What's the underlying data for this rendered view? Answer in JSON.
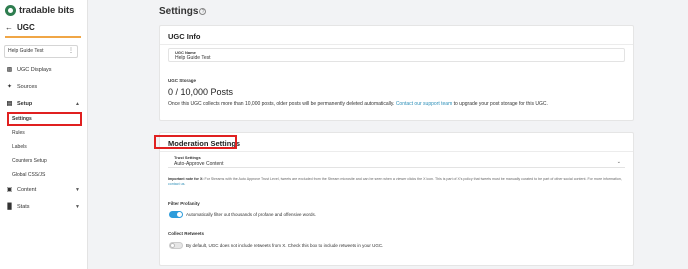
{
  "sidebar": {
    "brand": "tradable bits",
    "back_label": "UGC",
    "select_value": "Help Guide Test",
    "items": {
      "displays": "UGC Displays",
      "sources": "Sources",
      "setup": "Setup",
      "settings": "Settings",
      "rules": "Rules",
      "labels": "Labels",
      "counters": "Counters Setup",
      "global": "Global CSS/JS",
      "content": "Content",
      "stats": "Stats"
    }
  },
  "page": {
    "title": "Settings",
    "help": "?"
  },
  "ugc_info": {
    "title": "UGC Info",
    "name_label": "UGC Name",
    "name_value": "Help Guide Test",
    "storage_label": "UGC Storage",
    "storage_count": "0 / 10,000 Posts",
    "storage_note_before": "Once this UGC collects more than 10,000 posts, older posts will be permanently deleted automatically. ",
    "storage_note_link": "Contact our support team",
    "storage_note_after": " to upgrade your post storage for this UGC."
  },
  "moderation": {
    "title": "Moderation Settings",
    "trust_label": "Trust Settings",
    "trust_value": "Auto-Approve Content",
    "note_bold": "Important note for X:",
    "note_text": " For Streams with the Auto Approve Trust Level, tweets are excluded from the Stream microsite and can be seen when a viewer clicks the X icon. This is part of X's policy that tweets must be manually curated to be part of other social content. For more information, ",
    "note_link": "contact us",
    "note_end": ".",
    "profanity_title": "Filter Profanity",
    "profanity_text": "Automatically filter out thousands of profane and offensive words.",
    "profanity_on": true,
    "retweets_title": "Collect Retweets",
    "retweets_text": "By default, UGC does not include retweets from X. Check this box to include retweets in your UGC.",
    "retweets_on": false
  },
  "colors": {
    "brand_green": "#2e7d4f",
    "accent_orange": "#f0a646",
    "highlight_red": "#e02020",
    "link_blue": "#2d8fb8",
    "toggle_blue": "#2d9cdb"
  }
}
